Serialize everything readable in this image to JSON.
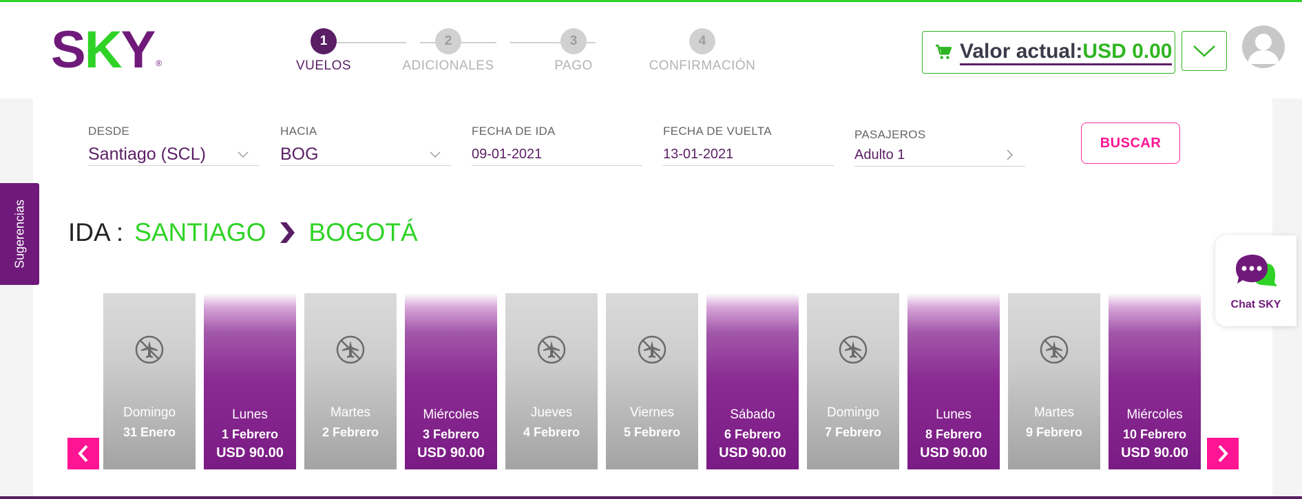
{
  "brand": {
    "logo_main": "S",
    "logo_k": "K",
    "logo_end": "Y",
    "logo_reg": "®",
    "colors": {
      "purple": "#6f1a7a",
      "green": "#2fd326",
      "pink": "#ff1493"
    }
  },
  "steps": [
    {
      "number": "1",
      "label": "VUELOS",
      "active": true
    },
    {
      "number": "2",
      "label": "ADICIONALES",
      "active": false
    },
    {
      "number": "3",
      "label": "PAGO",
      "active": false
    },
    {
      "number": "4",
      "label": "CONFIRMACIÓN",
      "active": false
    }
  ],
  "cart": {
    "label": "Valor actual:",
    "value": "USD 0.00",
    "icon": "cart-icon"
  },
  "search": {
    "desde": {
      "label": "DESDE",
      "value": "Santiago (SCL)"
    },
    "hacia": {
      "label": "HACIA",
      "value": "BOG"
    },
    "fecha_ida": {
      "label": "FECHA DE IDA",
      "value": "09-01-2021"
    },
    "fecha_vuelta": {
      "label": "FECHA DE VUELTA",
      "value": "13-01-2021"
    },
    "pasajeros": {
      "label": "PASAJEROS",
      "value": "Adulto 1"
    },
    "button": "BUSCAR"
  },
  "route": {
    "prefix": "IDA :",
    "origin": "SANTIAGO",
    "destination": "BOGOTÁ"
  },
  "days": [
    {
      "day": "Domingo",
      "date": "31 Enero",
      "price": null
    },
    {
      "day": "Lunes",
      "date": "1 Febrero",
      "price": "USD 90.00"
    },
    {
      "day": "Martes",
      "date": "2 Febrero",
      "price": null
    },
    {
      "day": "Miércoles",
      "date": "3 Febrero",
      "price": "USD 90.00"
    },
    {
      "day": "Jueves",
      "date": "4 Febrero",
      "price": null
    },
    {
      "day": "Viernes",
      "date": "5 Febrero",
      "price": null
    },
    {
      "day": "Sábado",
      "date": "6 Febrero",
      "price": "USD 90.00"
    },
    {
      "day": "Domingo",
      "date": "7 Febrero",
      "price": null
    },
    {
      "day": "Lunes",
      "date": "8 Febrero",
      "price": "USD 90.00"
    },
    {
      "day": "Martes",
      "date": "9 Febrero",
      "price": null
    },
    {
      "day": "Miércoles",
      "date": "10 Febrero",
      "price": "USD 90.00"
    }
  ],
  "sugerencias": "Sugerencias",
  "chat": {
    "label": "Chat SKY"
  }
}
